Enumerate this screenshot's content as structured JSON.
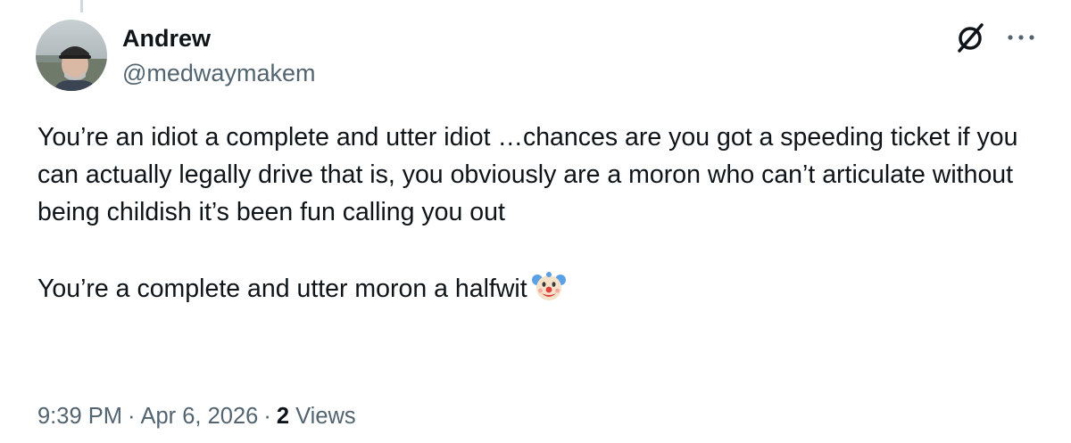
{
  "author": {
    "display_name": "Andrew",
    "handle": "@medwaymakem"
  },
  "tweet": {
    "paragraphs": [
      "You’re an idiot a complete and utter idiot …chances are you got a speeding ticket if you can actually legally drive that is,  you obviously are a moron who can’t articulate without being childish it’s been fun calling you out",
      "You’re a complete and utter moron a halfwit"
    ],
    "emoji": "clown-face"
  },
  "meta": {
    "time": "9:39 PM",
    "separator": "·",
    "date": "Apr 6, 2026",
    "views_count": "2",
    "views_label": "Views"
  },
  "icons": {
    "grok": "grok-icon",
    "more": "more-icon"
  },
  "colors": {
    "text_primary": "#0f1419",
    "text_secondary": "#536471",
    "thread_line": "#cfd9de"
  }
}
